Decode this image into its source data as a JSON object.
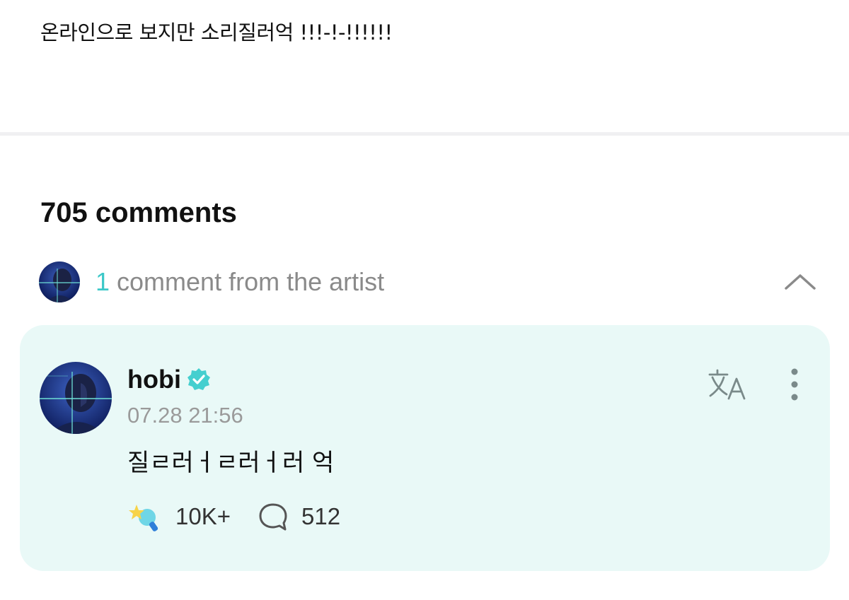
{
  "post": {
    "text": "온라인으로 보지만 소리질러억 !!!-!-!!!!!!"
  },
  "comments": {
    "count_label": "705 comments"
  },
  "artist_section": {
    "count": "1",
    "label": " comment from the artist",
    "avatar_icon": "artist-avatar",
    "toggle_icon": "chevron-up-icon"
  },
  "artist_comment": {
    "author": "hobi",
    "verified_icon": "verified-badge-icon",
    "timestamp": "07.28 21:56",
    "body": "질ㄹ러ㅓㄹ러ㅓ러 억",
    "likes": "10K+",
    "replies": "512",
    "translate_icon": "translate-icon",
    "more_icon": "more-vertical-icon",
    "like_icon": "star-lightstick-icon",
    "reply_icon": "reply-bubble-icon"
  },
  "colors": {
    "accent": "#3cc8c8",
    "card_bg": "#e9f9f7",
    "muted_text": "#8a8a8a"
  }
}
